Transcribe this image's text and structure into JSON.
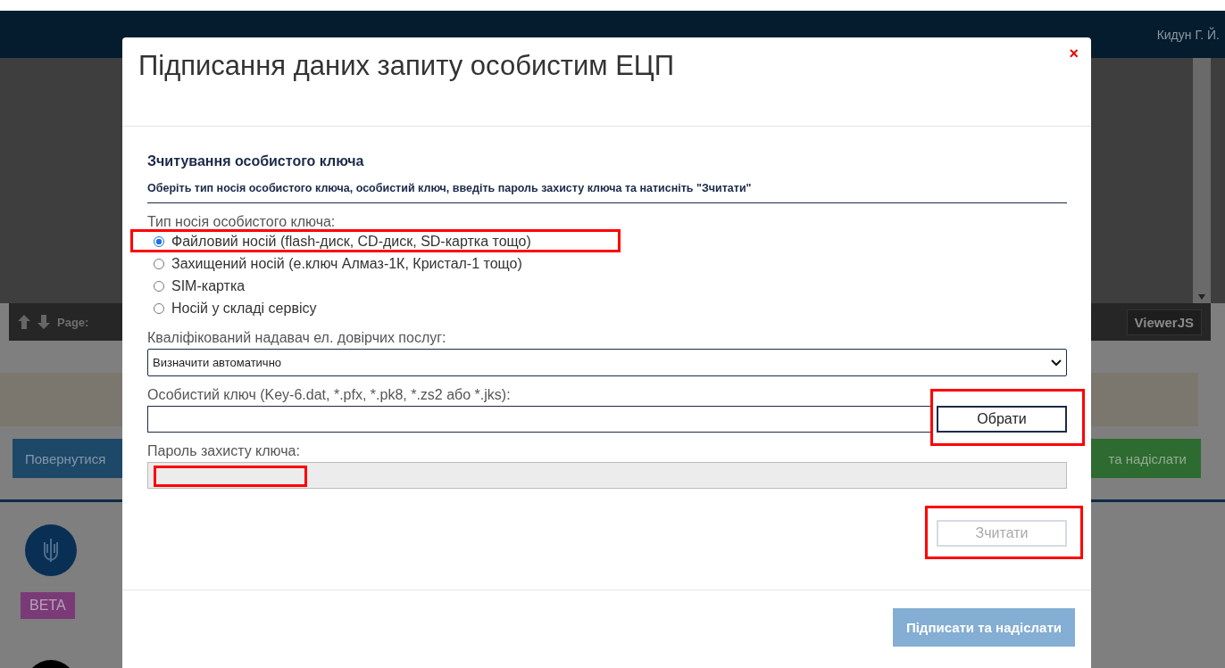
{
  "header": {
    "user": "Кидун Г. Й."
  },
  "viewer": {
    "page_label": "Page:",
    "brand_button": "ViewerJS"
  },
  "page": {
    "back_button": "Повернутися",
    "send_button": "та надіслати",
    "beta_badge": "BETA"
  },
  "modal": {
    "title": "Підписання даних запиту особистим ЕЦП",
    "close": "×",
    "section_title": "Зчитування особистого ключа",
    "instruction": "Оберіть тип носія особистого ключа, особистий ключ, введіть пароль захисту ключа та натисніть \"Зчитати\"",
    "media_label": "Тип носія особистого ключа:",
    "media_options": [
      {
        "label": "Файловий носій (flash-диск, CD-диск, SD-картка тощо)",
        "selected": true,
        "highlighted": true
      },
      {
        "label": "Захищений носій (е.ключ Алмаз-1К, Кристал-1 тощо)",
        "selected": false,
        "highlighted": false
      },
      {
        "label": "SIM-картка",
        "selected": false,
        "highlighted": false
      },
      {
        "label": "Носій у складі сервісу",
        "selected": false,
        "highlighted": false
      }
    ],
    "provider_label": "Кваліфікований надавач ел. довірчих послуг:",
    "provider_select": {
      "value": "Визначити автоматично"
    },
    "key_label": "Особистий ключ (Key-6.dat, *.pfx, *.pk8, *.zs2 або *.jks):",
    "browse_button": {
      "label": "Обрати",
      "highlighted": true
    },
    "password_label": "Пароль захисту ключа:",
    "password_field": {
      "disabled": true,
      "highlighted": true
    },
    "read_button": {
      "label": "Зчитати",
      "disabled": true,
      "highlighted": true
    },
    "sign_button": {
      "label": "Підписати та надіслати",
      "disabled": true
    }
  }
}
